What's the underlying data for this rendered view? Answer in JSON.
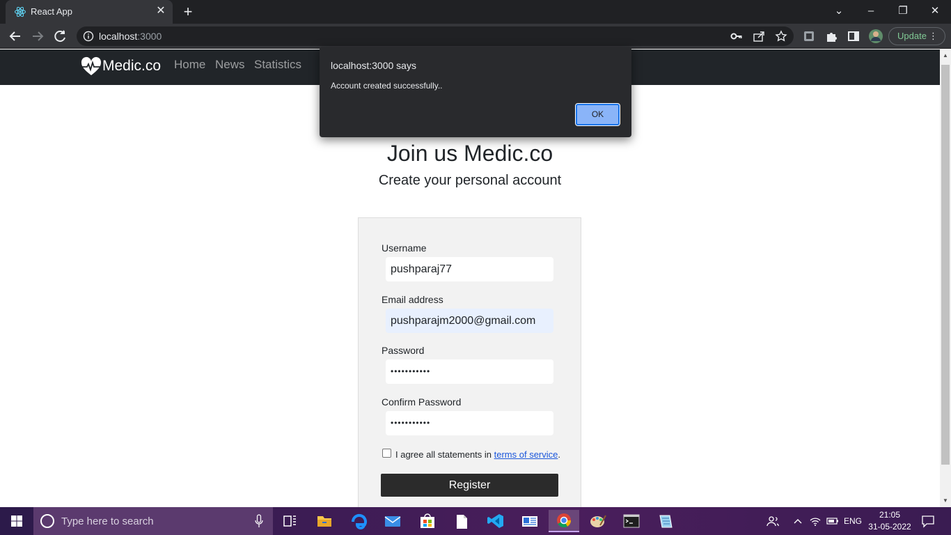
{
  "browser": {
    "tab_title": "React App",
    "url_host": "localhost",
    "url_port": ":3000",
    "update_label": "Update"
  },
  "navbar": {
    "brand": "Medic.co",
    "links": [
      {
        "label": "Home"
      },
      {
        "label": "News"
      },
      {
        "label": "Statistics"
      }
    ]
  },
  "alert": {
    "title": "localhost:3000 says",
    "message": "Account created successfully..",
    "ok_label": "OK"
  },
  "page": {
    "heading": "Join us Medic.co",
    "subheading": "Create your personal account"
  },
  "form": {
    "username_label": "Username",
    "username_value": "pushparaj77",
    "email_label": "Email address",
    "email_value": "pushparajm2000@gmail.com",
    "password_label": "Password",
    "password_value": "•••••••••••",
    "confirm_label": "Confirm Password",
    "confirm_value": "•••••••••••",
    "agree_text": "I agree all statements in ",
    "terms_link": "terms of service",
    "agree_suffix": ".",
    "agree_checked": false,
    "register_label": "Register"
  },
  "taskbar": {
    "search_placeholder": "Type here to search",
    "language": "ENG",
    "time": "21:05",
    "date": "31-05-2022"
  },
  "colors": {
    "navbar_bg": "#212529",
    "alert_bg": "#292a2d",
    "ok_button": "#8ab4f8",
    "register_button": "#2b2b2b",
    "link": "#1a56db"
  }
}
